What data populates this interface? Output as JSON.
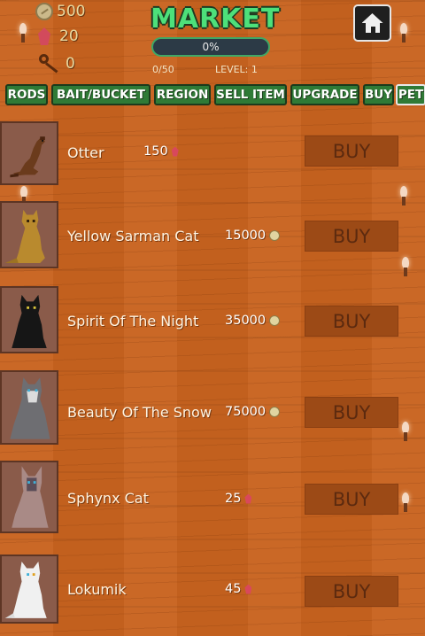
{
  "header": {
    "coins": "500",
    "gems": "20",
    "keys": "0",
    "title": "MARKET",
    "progress_text": "0%",
    "progress_fraction": 0,
    "xp": "0/50",
    "level": "LEVEL: 1"
  },
  "tabs": [
    {
      "label": "RODS"
    },
    {
      "label": "BAIT/BUCKET"
    },
    {
      "label": "REGION"
    },
    {
      "label": "SELL ITEM"
    },
    {
      "label": "UPGRADE"
    },
    {
      "label": "BUY"
    },
    {
      "label": "PET",
      "active": true
    }
  ],
  "pets": [
    {
      "name": "Otter",
      "price": "150",
      "currency": "gem",
      "buy_label": "BUY",
      "icon": "otter"
    },
    {
      "name": "Yellow Sarman Cat",
      "price": "15000",
      "currency": "coin",
      "buy_label": "BUY",
      "icon": "yellow-cat"
    },
    {
      "name": "Spirit Of The Night",
      "price": "35000",
      "currency": "coin",
      "buy_label": "BUY",
      "icon": "black-cat"
    },
    {
      "name": "Beauty Of The Snow",
      "price": "75000",
      "currency": "coin",
      "buy_label": "BUY",
      "icon": "grey-cat"
    },
    {
      "name": "Sphynx Cat",
      "price": "25",
      "currency": "gem",
      "buy_label": "BUY",
      "icon": "sphynx-cat"
    },
    {
      "name": "Lokumik",
      "price": "45",
      "currency": "gem",
      "buy_label": "BUY",
      "icon": "white-cat"
    }
  ],
  "colors": {
    "background": "#c8631f",
    "title": "#4de07a",
    "tab": "#2f7a36",
    "buy_button": "#9c4a16",
    "gem": "#d8485c",
    "coin": "#e0d4a0"
  }
}
